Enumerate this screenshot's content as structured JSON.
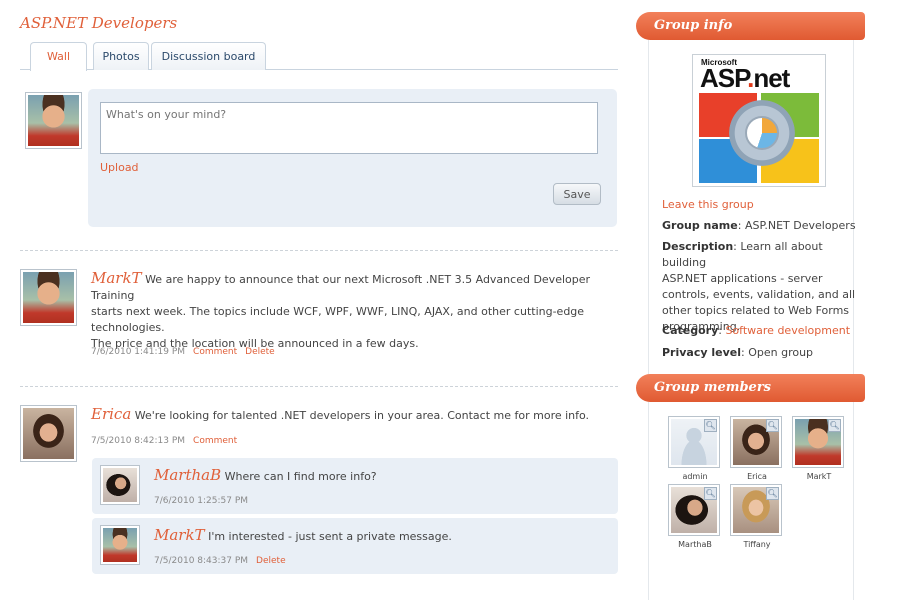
{
  "group": {
    "title": "ASP.NET Developers"
  },
  "tabs": [
    {
      "label": "Wall",
      "active": true
    },
    {
      "label": "Photos",
      "active": false
    },
    {
      "label": "Discussion board",
      "active": false
    }
  ],
  "composer": {
    "placeholder": "What's on your mind?",
    "upload_label": "Upload",
    "save_label": "Save"
  },
  "posts": [
    {
      "author": "MarkT",
      "avatar": "photo-man",
      "body_line1": "We are happy to announce that our next Microsoft .NET 3.5 Advanced Developer Training",
      "body_line2": "starts next week. The topics include WCF, WPF, WWF, LINQ, AJAX, and other cutting-edge",
      "body_line3": "technologies.",
      "body_line4": "The price and the location will be announced in a few days.",
      "timestamp": "7/6/2010 1:41:19 PM",
      "comment_label": "Comment",
      "delete_label": "Delete"
    },
    {
      "author": "Erica",
      "avatar": "photo-woman-sunglasses",
      "body": "We're looking for talented .NET developers in your area. Contact me for more info.",
      "timestamp": "7/5/2010 8:42:13 PM",
      "comment_label": "Comment",
      "replies": [
        {
          "author": "MarthaB",
          "avatar": "photo-woman-dark-hair",
          "body": "Where can I find more info?",
          "timestamp": "7/6/2010 1:25:57 PM"
        },
        {
          "author": "MarkT",
          "avatar": "photo-man",
          "body": "I'm interested - just sent a private message.",
          "timestamp": "7/5/2010 8:43:37 PM",
          "delete_label": "Delete"
        }
      ]
    }
  ],
  "sidebar": {
    "group_info_heading": "Group info",
    "logo": {
      "small_text": "Microsoft",
      "main_text_a": "ASP",
      "main_text_dot": ".",
      "main_text_b": "net"
    },
    "leave_label": "Leave this group",
    "group_name_label": "Group name",
    "group_name_value": "ASP.NET Developers",
    "description_label": "Description",
    "description_line1": "Learn all about building",
    "description_line2": "ASP.NET applications - server",
    "description_line3": "controls, events, validation, and all",
    "description_line4": "other topics related to Web Forms",
    "description_line5": "programming.",
    "category_label": "Category",
    "category_value": "Software development",
    "privacy_label": "Privacy level",
    "privacy_value": "Open group",
    "members_heading": "Group members",
    "members": [
      {
        "name": "admin",
        "avatar": "placeholder-silhouette"
      },
      {
        "name": "Erica",
        "avatar": "photo-woman-sunglasses"
      },
      {
        "name": "MarkT",
        "avatar": "photo-man"
      },
      {
        "name": "MarthaB",
        "avatar": "photo-woman-dark-hair"
      },
      {
        "name": "Tiffany",
        "avatar": "photo-woman-blonde"
      }
    ],
    "zoom_icon": "magnifier-icon"
  },
  "colors": {
    "accent": "#e0603a",
    "panel_bg": "#e9eff6",
    "header_gradient_top": "#f2805a",
    "header_gradient_bottom": "#e05a32"
  }
}
